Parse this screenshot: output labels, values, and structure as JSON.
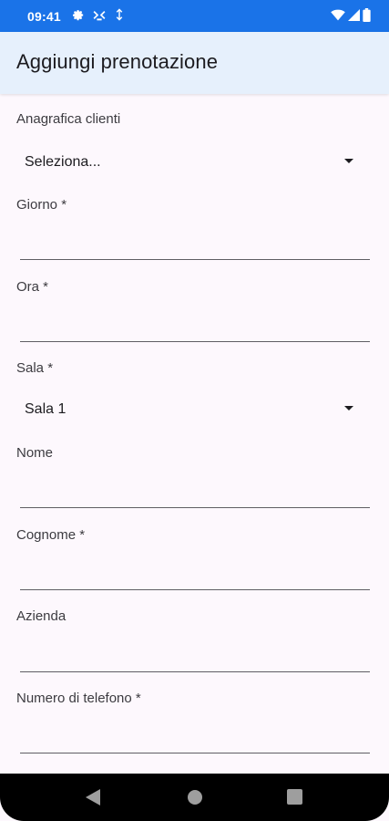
{
  "status_bar": {
    "time": "09:41",
    "icons": [
      "settings-icon",
      "accessibility-icon",
      "data-saver-icon",
      "wifi-icon",
      "signal-icon",
      "battery-icon"
    ]
  },
  "app_bar": {
    "title": "Aggiungi prenotazione"
  },
  "form": {
    "cliente": {
      "label": "Anagrafica clienti",
      "value": "Seleziona..."
    },
    "giorno": {
      "label": "Giorno *",
      "value": ""
    },
    "ora": {
      "label": "Ora *",
      "value": ""
    },
    "sala": {
      "label": "Sala *",
      "value": "Sala 1"
    },
    "nome": {
      "label": "Nome",
      "value": ""
    },
    "cognome": {
      "label": "Cognome *",
      "value": ""
    },
    "azienda": {
      "label": "Azienda",
      "value": ""
    },
    "telefono": {
      "label": "Numero di telefono *",
      "value": ""
    }
  },
  "nav_bar": {
    "buttons": [
      "back-icon",
      "home-icon",
      "recents-icon"
    ]
  },
  "colors": {
    "status_bar": "#1a73e8",
    "app_bar": "#e6f0fc",
    "background": "#fdf8fd"
  }
}
